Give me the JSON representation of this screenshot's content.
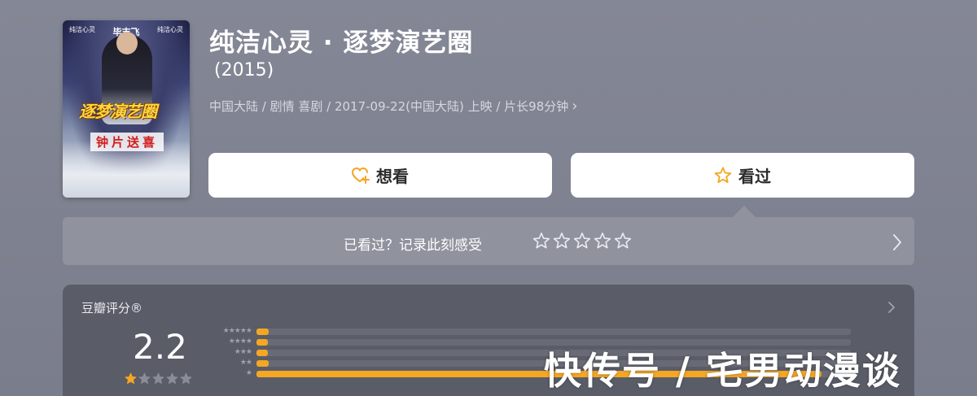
{
  "movie": {
    "title": "纯洁心灵 · 逐梦演艺圈",
    "year": "(2015)",
    "meta": "中国大陆 / 剧情 喜剧 / 2017-09-22(中国大陆) 上映 / 片长98分钟",
    "meta_chevron": "›"
  },
  "poster": {
    "top_left": "纯洁心灵",
    "top_actor": "毕志飞",
    "top_right": "纯洁心灵",
    "title_art": "逐梦演艺圈",
    "tagline": "钟片送喜"
  },
  "actions": {
    "want_label": "想看",
    "want_icon": "heart-plus-icon",
    "seen_label": "看过",
    "seen_icon": "star-outline-icon"
  },
  "rate": {
    "prompt": "已看过？记录此刻感受",
    "star_count": 5
  },
  "score": {
    "label": "豆瓣评分®",
    "value": "2.2",
    "stars_filled": 1,
    "stars_total": 5,
    "distribution": [
      {
        "stars": "★★★★★",
        "fraction": 0.02
      },
      {
        "stars": "★★★★",
        "fraction": 0.01
      },
      {
        "stars": "★★★",
        "fraction": 0.01
      },
      {
        "stars": "★★",
        "fraction": 0.02
      },
      {
        "stars": "★",
        "fraction": 0.95
      }
    ]
  },
  "watermark": {
    "text": "快传号 / 宅男动漫谈"
  },
  "colors": {
    "accent": "#f5a623",
    "background": "#818491",
    "card": "#5a5d68"
  }
}
